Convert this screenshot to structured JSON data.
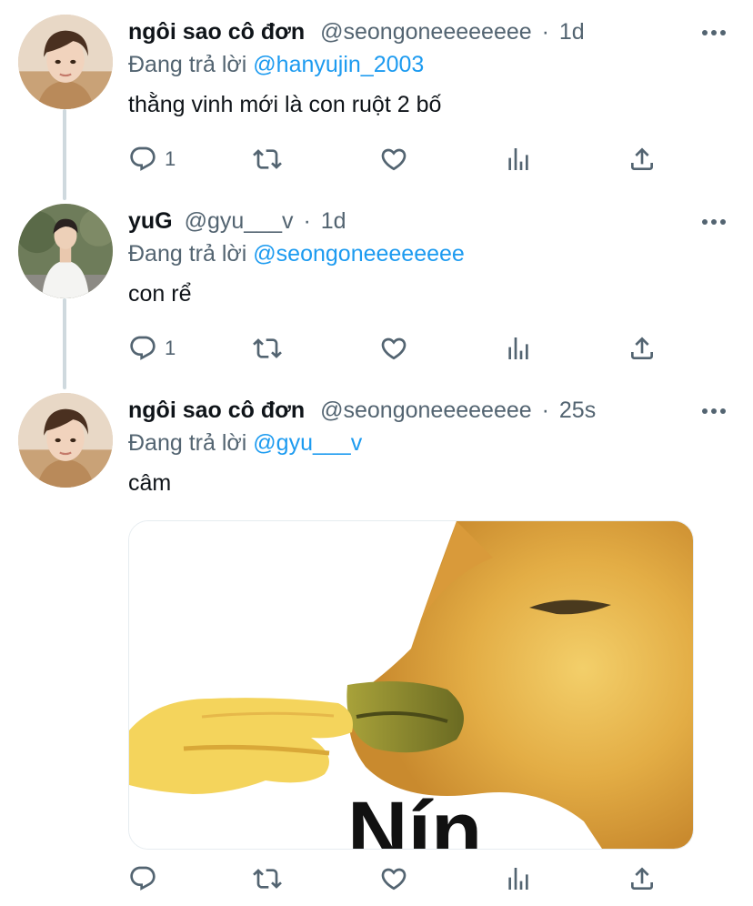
{
  "tweets": [
    {
      "display_name": "ngôi sao cô đơn",
      "handle": "@seongoneeeeeeee",
      "separator": "·",
      "time": "1d",
      "replying_to_label": "Đang trả lời",
      "replying_to": "@hanyujin_2003",
      "text": "thằng vinh mới là con ruột 2 bố",
      "reply_count": "1",
      "avatar": "avatar-boy-brown-hair"
    },
    {
      "display_name": "yuG",
      "handle": "@gyu___v",
      "separator": "·",
      "time": "1d",
      "replying_to_label": "Đang trả lời",
      "replying_to": "@seongoneeeeeeee",
      "text": "con rể",
      "reply_count": "1",
      "avatar": "avatar-boy-white-tshirt"
    },
    {
      "display_name": "ngôi sao cô đơn",
      "handle": "@seongoneeeeeeee",
      "separator": "·",
      "time": "25s",
      "replying_to_label": "Đang trả lời",
      "replying_to": "@gyu___v",
      "text": "câm",
      "reply_count": "",
      "avatar": "avatar-boy-brown-hair",
      "media": {
        "type": "meme-image",
        "description_icon": "dog-beak-pinch-meme",
        "caption": "Nín"
      }
    }
  ],
  "actions": [
    "reply-icon",
    "retweet-icon",
    "like-icon",
    "analytics-icon",
    "share-icon"
  ],
  "colors": {
    "link": "#1d9bf0",
    "secondary_text": "#536471",
    "thread_line": "#cfd9de"
  }
}
